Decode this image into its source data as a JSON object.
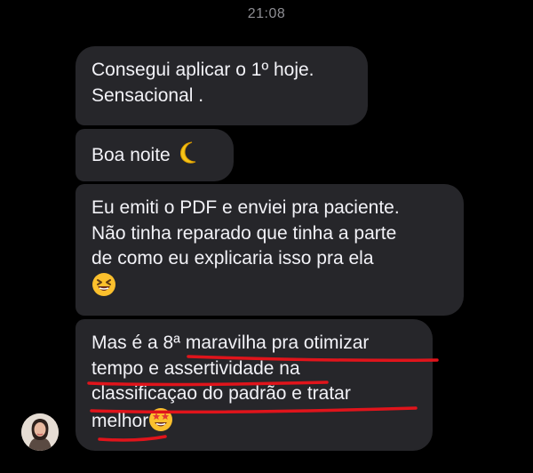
{
  "header": {
    "time": "21:08"
  },
  "messages": [
    {
      "lines": [
        "Consegui aplicar o 1º hoje.",
        "Sensacional ."
      ]
    },
    {
      "lines": [
        "Boa noite"
      ],
      "emoji": "crescent-moon"
    },
    {
      "lines": [
        "Eu emiti o PDF e enviei pra paciente.",
        "Não tinha reparado que tinha a parte",
        "de como eu explicaria isso pra ela"
      ],
      "emoji": "laughing-face"
    },
    {
      "lines": [
        "Mas é a 8ª maravilha pra otimizar",
        "tempo e assertividade na",
        "classificaçao do padrão e tratar",
        "melhor"
      ],
      "emoji": "star-struck-face"
    }
  ],
  "annotation": {
    "color": "#e0141b"
  },
  "colors": {
    "background": "#000000",
    "bubble": "#26262a",
    "text": "#f2f2f7",
    "timestamp": "#8e8e93"
  }
}
